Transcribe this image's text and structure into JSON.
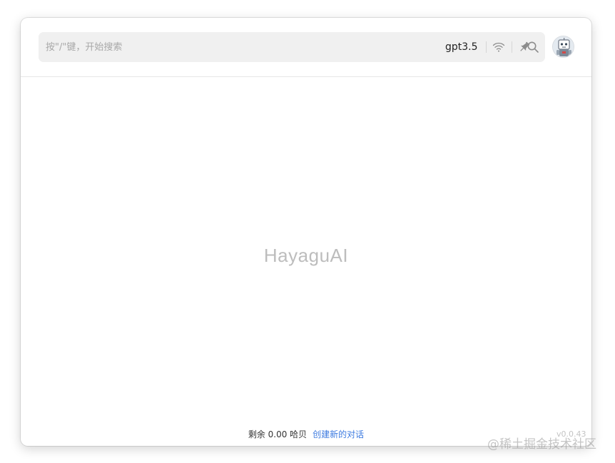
{
  "search": {
    "placeholder": "按\"/\"键，开始搜索",
    "model": "gpt3.5"
  },
  "toolbar": {
    "icons": [
      "wifi-icon",
      "pin-icon",
      "search-icon"
    ]
  },
  "main": {
    "brand": "HayaguAI"
  },
  "footer": {
    "balance_label": "剩余 0.00 哈贝",
    "new_chat_label": "创建新的对话",
    "version": "v0.0.43"
  },
  "watermark": "@稀土掘金技术社区",
  "colors": {
    "link": "#3d7be0",
    "search_bg": "#f0f0f0",
    "brand_text": "#bdbdbd"
  }
}
